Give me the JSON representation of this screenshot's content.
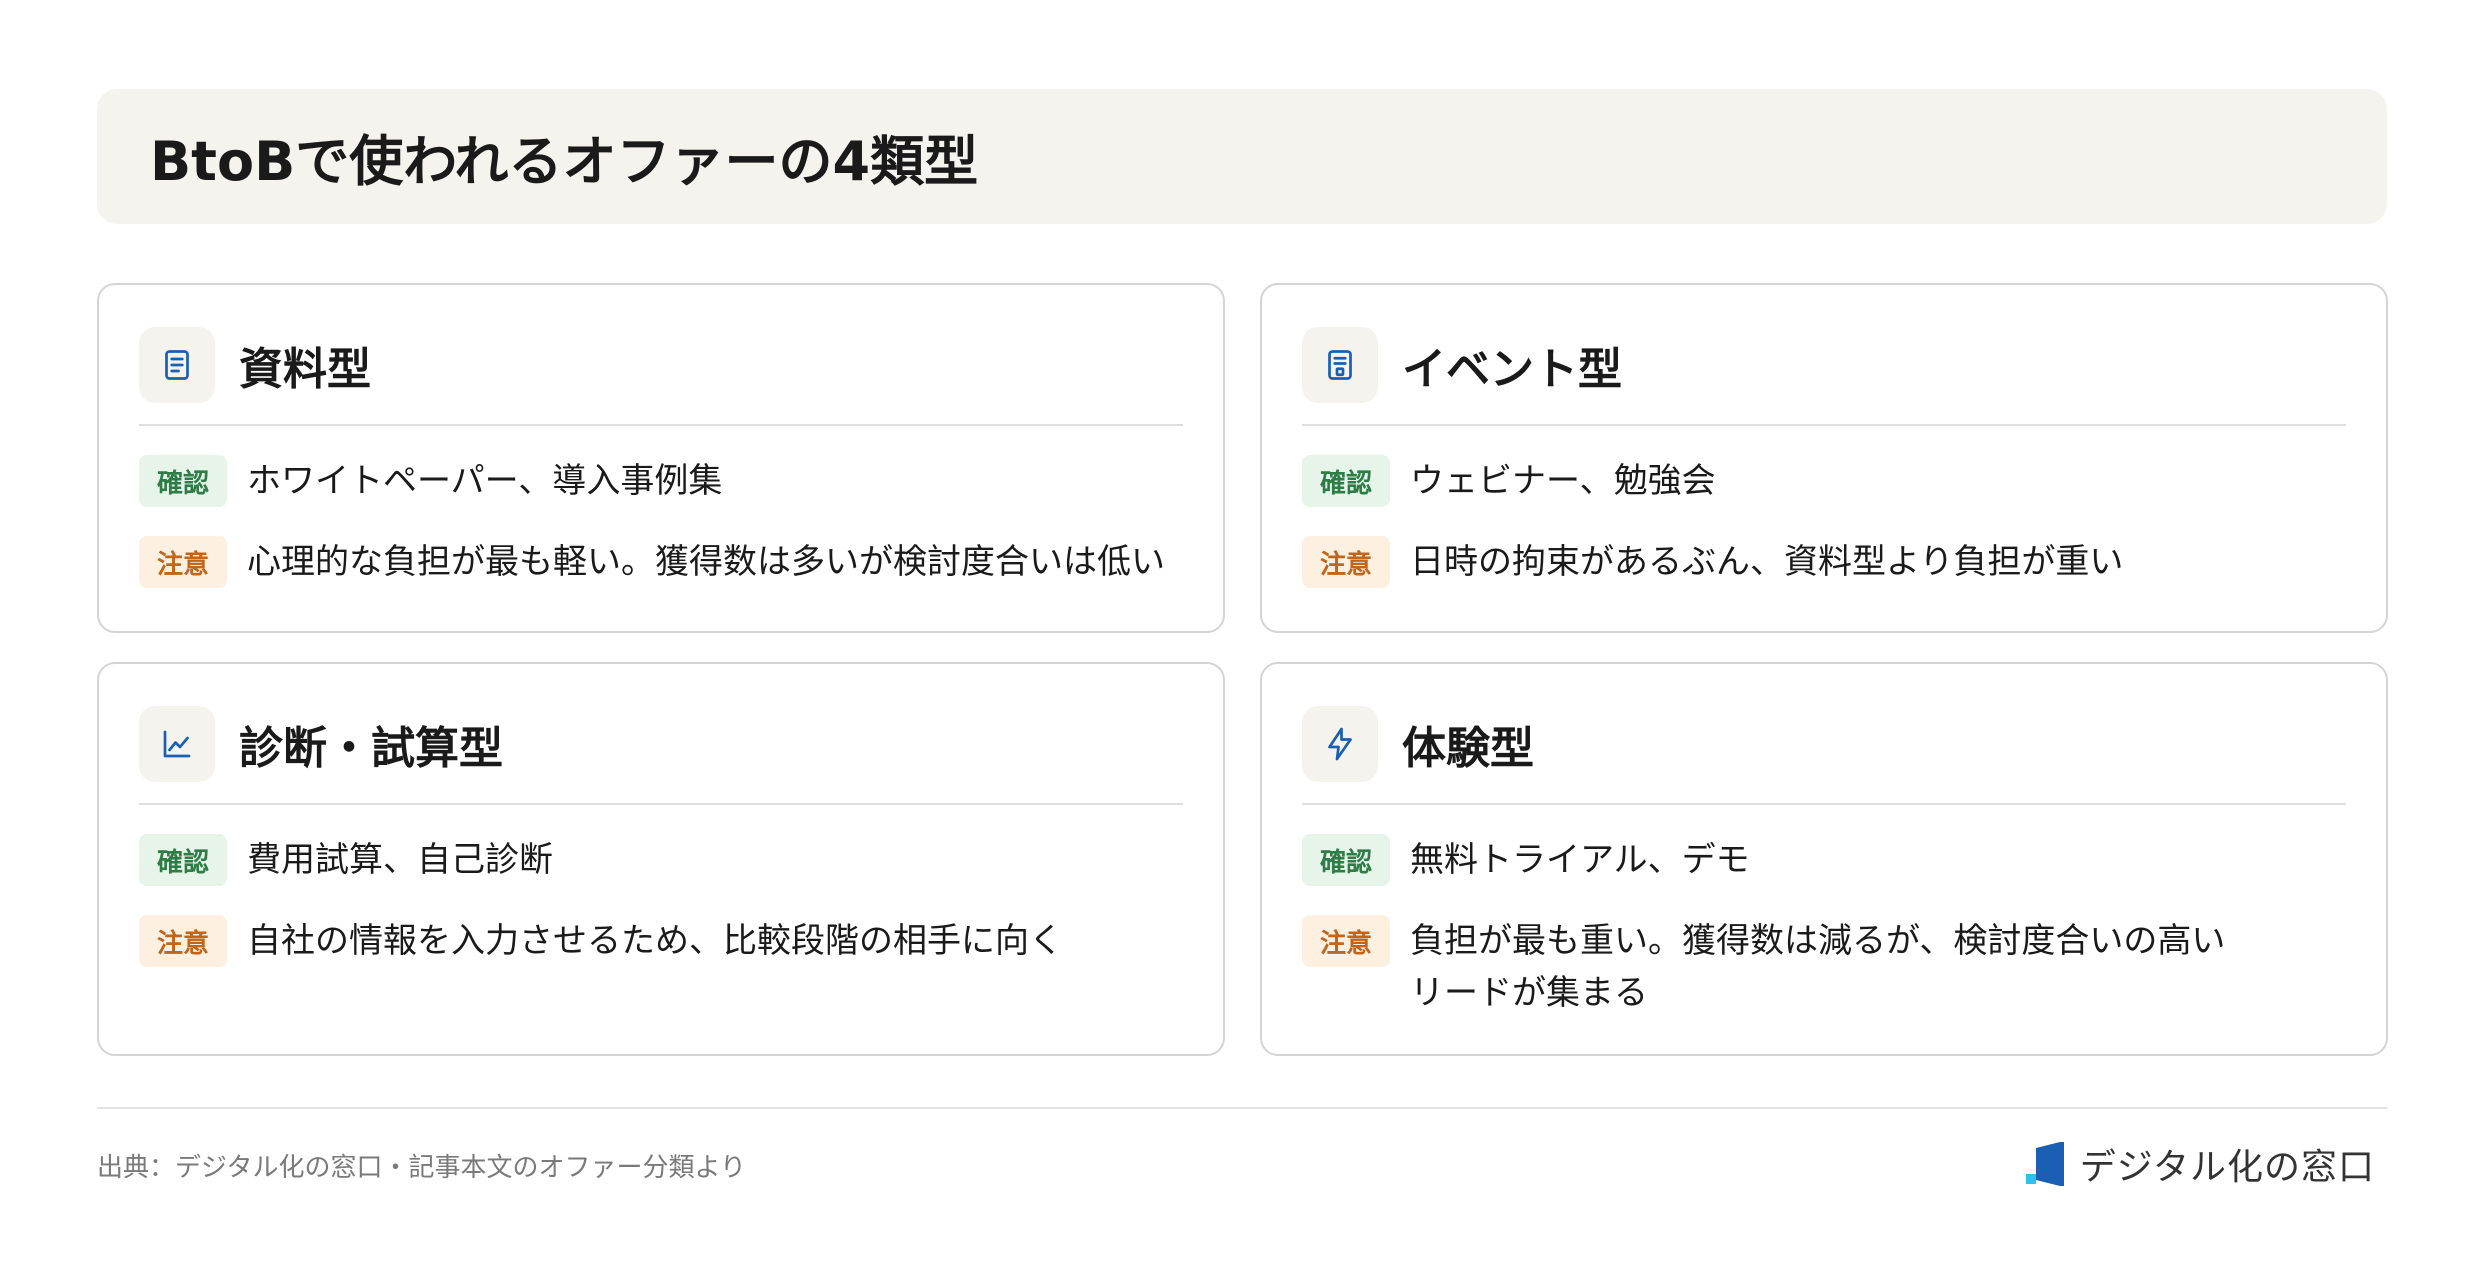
{
  "title": "BtoBで使われるオファーの4類型",
  "tags": {
    "confirm": "確認",
    "caution": "注意"
  },
  "cards": [
    {
      "icon": "document-icon",
      "title": "資料型",
      "confirm": "ホワイトペーパー、導入事例集",
      "caution": "心理的な負担が最も軽い。獲得数は多いが検討度合いは低い"
    },
    {
      "icon": "event-ticket-icon",
      "title": "イベント型",
      "confirm": "ウェビナー、勉強会",
      "caution": "日時の拘束があるぶん、資料型より負担が重い"
    },
    {
      "icon": "line-chart-icon",
      "title": "診断・試算型",
      "confirm": "費用試算、自己診断",
      "caution": "自社の情報を入力させるため、比較段階の相手に向く"
    },
    {
      "icon": "lightning-icon",
      "title": "体験型",
      "confirm": "無料トライアル、デモ",
      "caution": "負担が最も重い。獲得数は減るが、検討度合いの高い\nリードが集まる"
    }
  ],
  "footer": {
    "source": "出典：デジタル化の窓口・記事本文のオファー分類より",
    "brand": "デジタル化の窓口"
  },
  "colors": {
    "accent_blue": "#1a5fb4",
    "confirm_green": "#2e7d46",
    "caution_orange": "#c0651a"
  }
}
